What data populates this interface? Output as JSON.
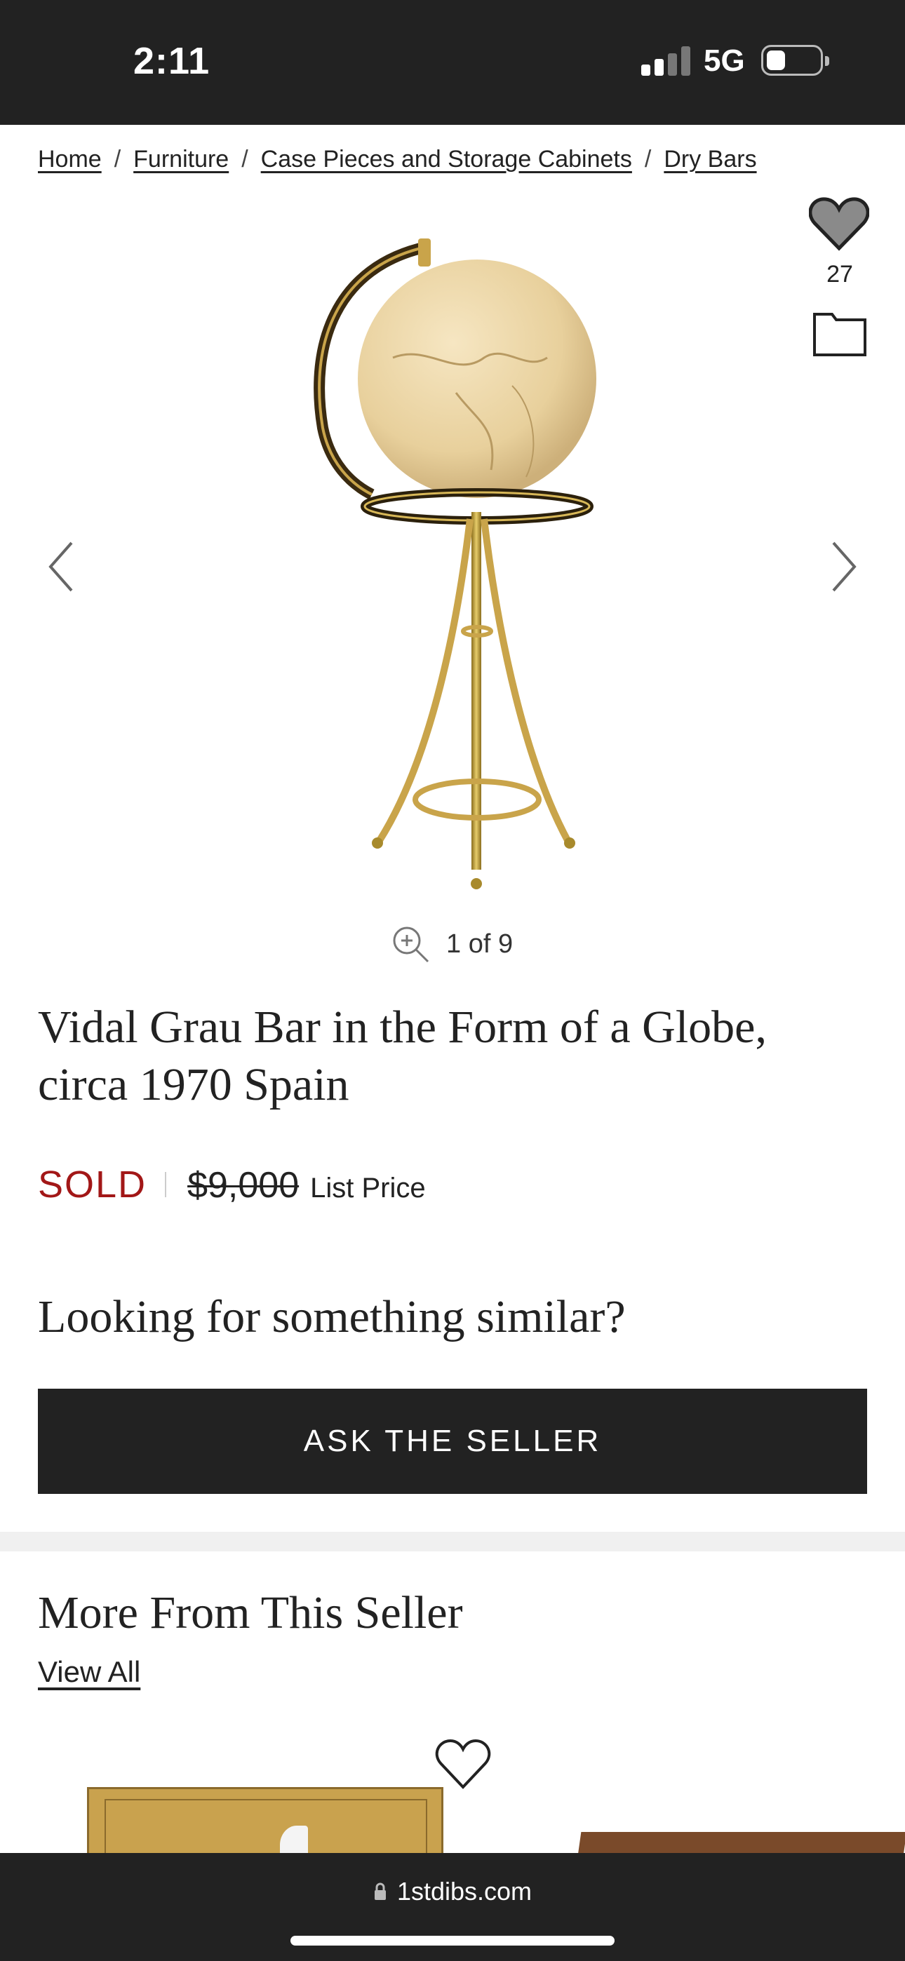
{
  "status_bar": {
    "time": "2:11",
    "network": "5G"
  },
  "breadcrumb": [
    {
      "label": "Home"
    },
    {
      "label": "Furniture"
    },
    {
      "label": "Case Pieces and Storage Cabinets"
    },
    {
      "label": "Dry Bars"
    }
  ],
  "gallery": {
    "favorites_count": "27",
    "counter": "1 of 9",
    "image_icon": "globe-bar-image"
  },
  "product": {
    "title": "Vidal Grau Bar in the Form of a Globe, circa 1970 Spain",
    "status": "SOLD",
    "price": "$9,000",
    "price_label": "List Price"
  },
  "similar": {
    "heading": "Looking for something similar?",
    "button_label": "ASK THE SELLER"
  },
  "seller": {
    "heading": "More From This Seller",
    "view_all": "View All"
  },
  "browser": {
    "url": "1stdibs.com"
  },
  "colors": {
    "sold": "#a21717",
    "dark": "#222222",
    "band": "#f0f0f0"
  }
}
